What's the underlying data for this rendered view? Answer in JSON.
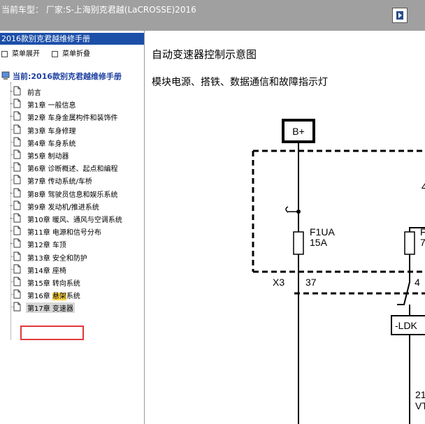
{
  "window": {
    "title": "当前车型： 厂家:S-上海别克君越(LaCROSSE)2016"
  },
  "icons": {
    "nav_button": "exit-arrow-icon",
    "menu_expand": "square-icon",
    "tree_root": "computer-book-icon",
    "tree_node": "document-page-icon"
  },
  "sidebar": {
    "manual_title": "2016款别克君越维修手册",
    "expand_label": "菜单展开",
    "collapse_label": "菜单折叠",
    "root_label": "当前:2016款别克君越维修手册",
    "items": [
      {
        "label": "前言"
      },
      {
        "label": "第1章 一般信息"
      },
      {
        "label": "第2章 车身金属构件和装饰件"
      },
      {
        "label": "第3章 车身修理"
      },
      {
        "label": "第4章 车身系统"
      },
      {
        "label": "第5章 制动器"
      },
      {
        "label": "第6章 诊断概述、起点和编程"
      },
      {
        "label": "第7章 传动系统/车桥"
      },
      {
        "label": "第8章 驾驶员信息和娱乐系统"
      },
      {
        "label": "第9章 发动机/推进系统"
      },
      {
        "label": "第10章 暖风、通风与空调系统"
      },
      {
        "label": "第11章 电源和信号分布"
      },
      {
        "label": "第12章 车顶"
      },
      {
        "label": "第13章 安全和防护"
      },
      {
        "label": "第14章 座椅"
      },
      {
        "label": "第15章 转向系统"
      },
      {
        "label_pre": "第16章 ",
        "label_hl": "悬架",
        "label_post": "系统"
      },
      {
        "label": "第17章 变速器",
        "selected": true
      }
    ]
  },
  "content": {
    "title": "自动变速器控制示意图",
    "subtitle": "模块电源、搭铁、数据通信和故障指示灯"
  },
  "diagram": {
    "battery_label": "B+",
    "fuse1_name": "F1UA",
    "fuse1_rating": "15A",
    "fuse2_name_partial": "F",
    "fuse2_rating_partial": "7",
    "connector": "X3",
    "pin1": "37",
    "pin2": "4",
    "ldk_label": "-LDK",
    "partial_top": "4",
    "partial_bottom1": "21",
    "partial_bottom2": "VT"
  }
}
